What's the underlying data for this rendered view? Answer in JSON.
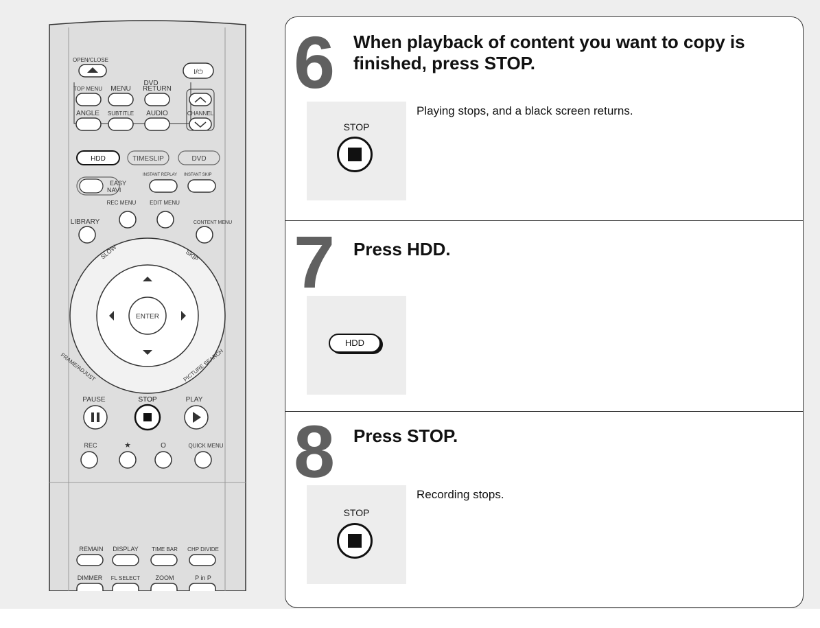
{
  "remote": {
    "open_close": "OPEN/CLOSE",
    "power": "I/⏻",
    "dvd_group": "DVD",
    "top_menu": "TOP MENU",
    "menu": "MENU",
    "return": "RETURN",
    "angle": "ANGLE",
    "subtitle": "SUBTITLE",
    "audio": "AUDIO",
    "channel": "CHANNEL",
    "hdd": "HDD",
    "timeslip": "TIMESLIP",
    "dvd": "DVD",
    "easy_navi_1": "EASY",
    "easy_navi_2": "NAVI",
    "instant_replay": "INSTANT REPLAY",
    "instant_skip": "INSTANT SKIP",
    "rec_menu": "REC MENU",
    "edit_menu": "EDIT MENU",
    "library": "LIBRARY",
    "content_menu": "CONTENT MENU",
    "slow": "SLOW",
    "skip": "SKIP",
    "enter": "ENTER",
    "frame_adjust": "FRAME/ADJUST",
    "picture_search": "PICTURE SEARCH",
    "pause": "PAUSE",
    "stop": "STOP",
    "play": "PLAY",
    "rec": "REC",
    "star": "★",
    "circle": "O",
    "quick_menu": "QUICK MENU",
    "remain": "REMAIN",
    "display": "DISPLAY",
    "time_bar": "TIME BAR",
    "chp_divide": "CHP DIVIDE",
    "dimmer": "DIMMER",
    "fl_select": "FL SELECT",
    "zoom": "ZOOM",
    "p_in_p": "P in P"
  },
  "steps": [
    {
      "number": "6",
      "title_line1": "When playback of content you want to copy is",
      "title_line2": "finished, press STOP.",
      "button_label": "STOP",
      "description": "Playing stops, and a black screen returns."
    },
    {
      "number": "7",
      "title_line1": "Press HDD.",
      "button_label": "HDD"
    },
    {
      "number": "8",
      "title_line1": "Press STOP.",
      "button_label": "STOP",
      "description": "Recording stops."
    }
  ]
}
